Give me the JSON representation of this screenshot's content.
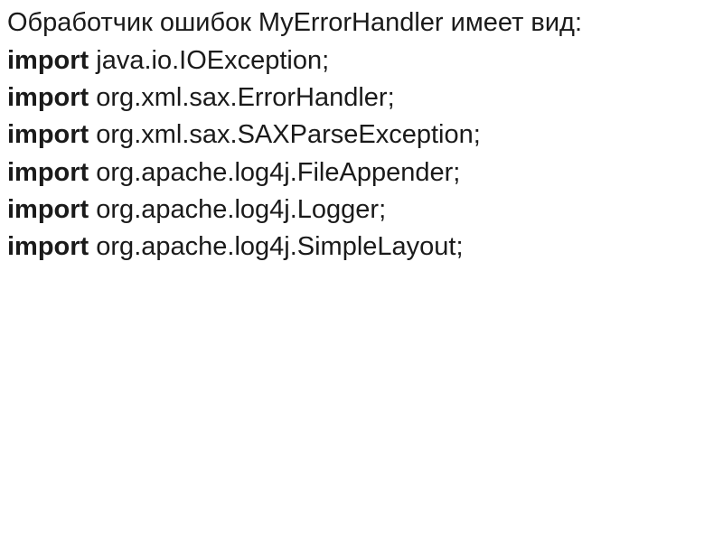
{
  "heading": "Обработчик ошибок MyErrorHandler имеет вид:",
  "lines": [
    {
      "keyword": "import",
      "rest": " java.io.IOException;"
    },
    {
      "keyword": "import",
      "rest": " org.xml.sax.ErrorHandler;"
    },
    {
      "keyword": "import",
      "rest": " org.xml.sax.SAXParseException;"
    },
    {
      "keyword": "import",
      "rest": " org.apache.log4j.FileAppender;"
    },
    {
      "keyword": "import",
      "rest": " org.apache.log4j.Logger;"
    },
    {
      "keyword": "import",
      "rest": " org.apache.log4j.SimpleLayout;"
    }
  ]
}
